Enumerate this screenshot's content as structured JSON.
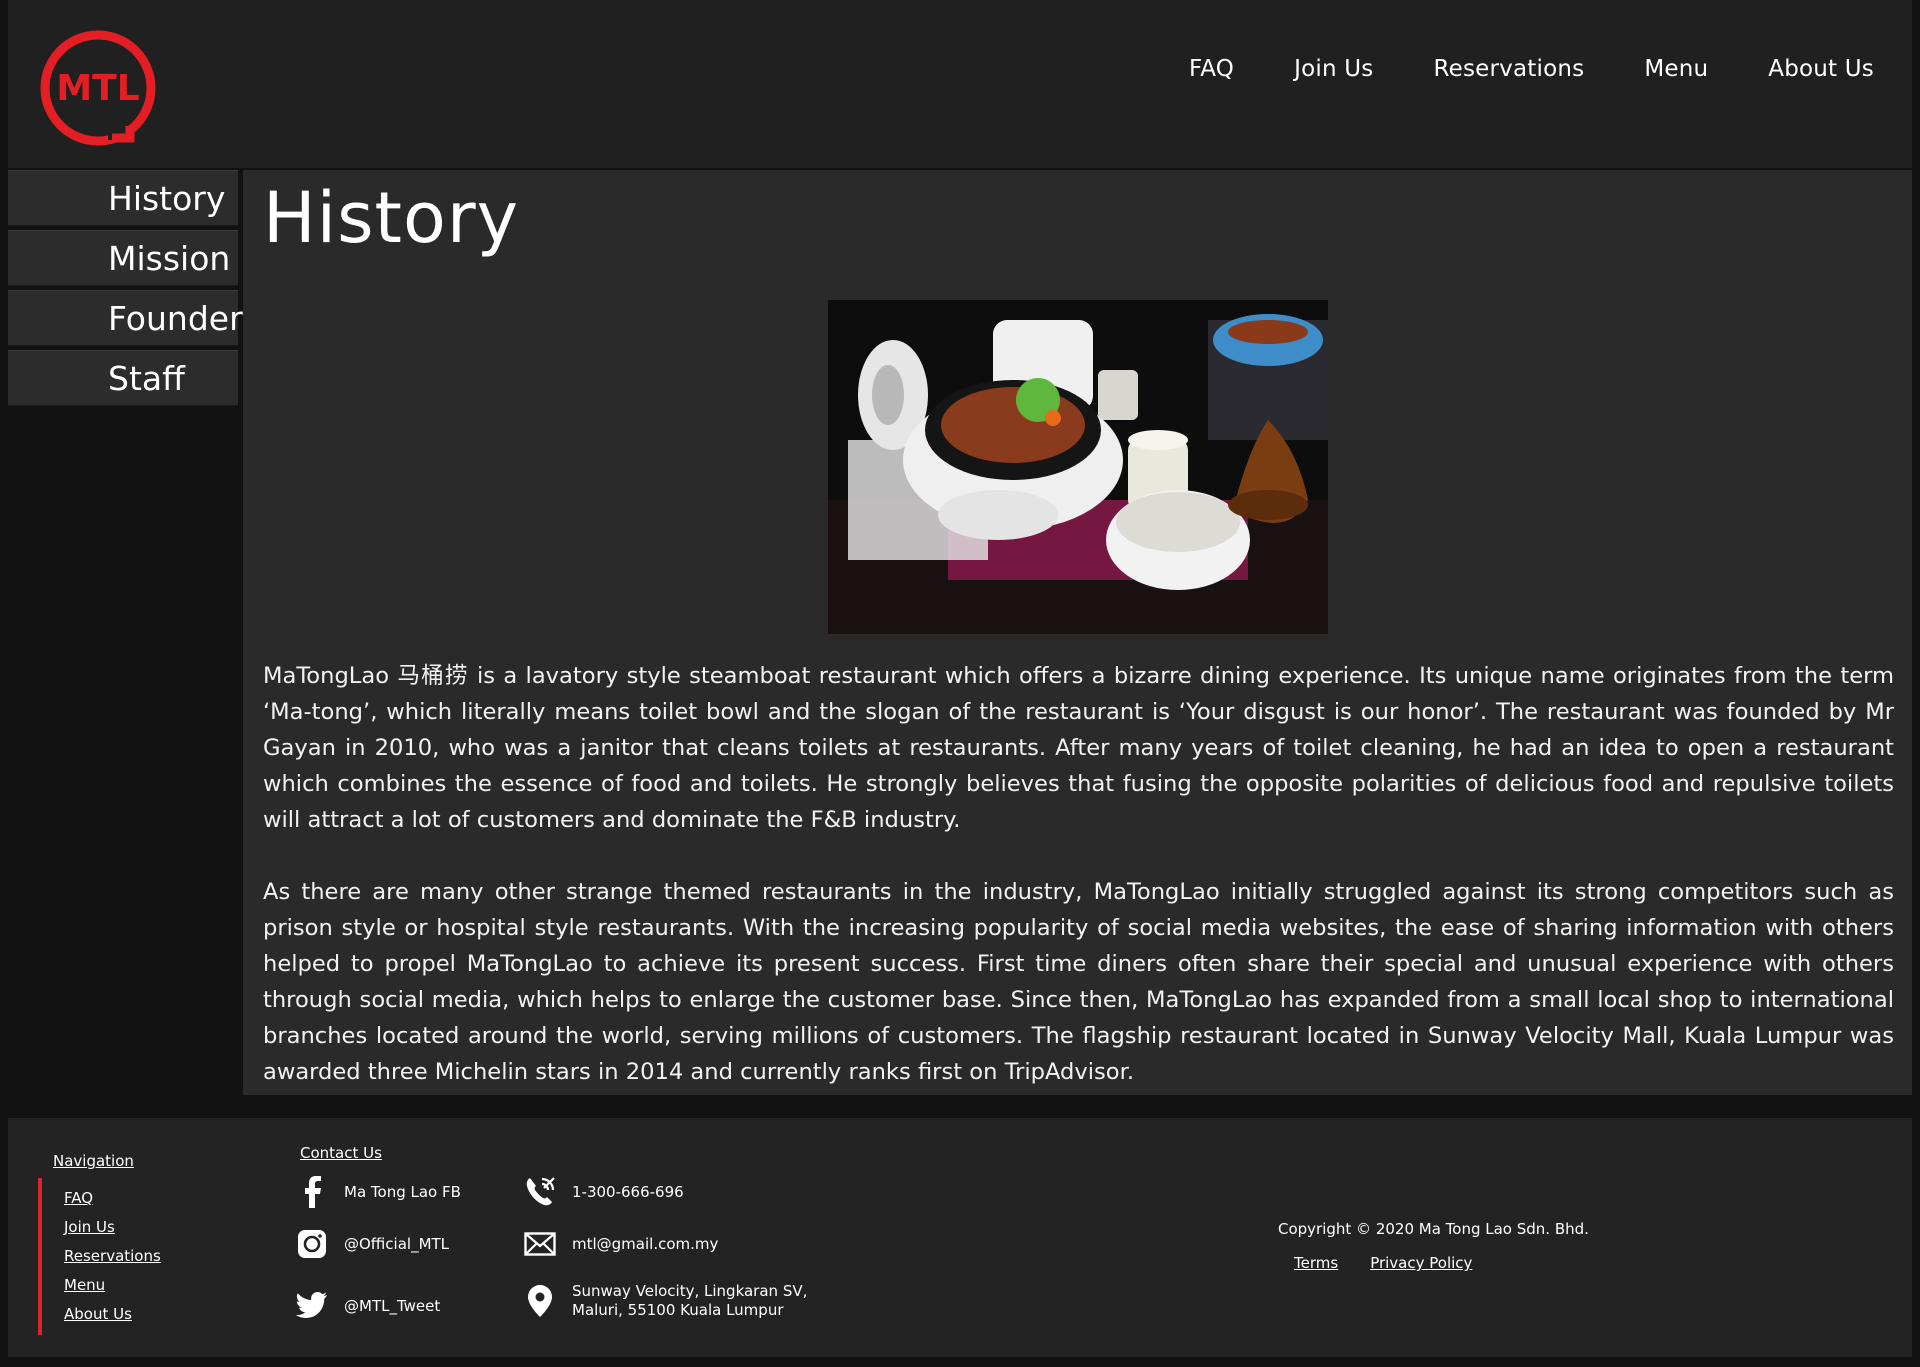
{
  "header": {
    "logo_text": "MTL",
    "nav": [
      "FAQ",
      "Join Us",
      "Reservations",
      "Menu",
      "About Us"
    ]
  },
  "sidebar": {
    "items": [
      "History",
      "Mission",
      "Founder",
      "Staff"
    ]
  },
  "main": {
    "title": "History",
    "paragraphs": [
      "MaTongLao 马桶捞 is a lavatory style steamboat restaurant which offers a bizarre dining experience. Its unique name originates from the term ‘Ma-tong’, which literally means toilet bowl and the slogan of the restaurant is ‘Your disgust is our honor’. The restaurant was founded by Mr Gayan in 2010, who was a janitor that cleans toilets at restaurants. After many years of toilet cleaning, he had an idea to open a restaurant which combines the essence of food and toilets. He strongly believes that fusing the opposite polarities of delicious food and repulsive toilets will attract a lot of customers and dominate the F&B industry.",
      "As there are many other strange themed restaurants in the industry, MaTongLao initially struggled against its strong competitors such as prison style or hospital style restaurants. With the increasing popularity of social media websites, the ease of sharing information with others helped to propel MaTongLao to achieve its present success. First time diners often share their special and unusual experience with others through social media, which helps to enlarge the customer base. Since then, MaTongLao has expanded from a small local shop to international branches located around the world, serving millions of customers. The flagship restaurant located in Sunway Velocity Mall, Kuala Lumpur was awarded three Michelin stars in 2014 and currently ranks first on TripAdvisor."
    ]
  },
  "footer": {
    "navigation_heading": "Navigation",
    "nav": [
      "FAQ",
      "Join Us",
      "Reservations",
      "Menu",
      "About Us"
    ],
    "contact_heading": "Contact Us",
    "facebook": "Ma Tong Lao FB",
    "instagram": "@Official_MTL",
    "twitter": "@MTL_Tweet",
    "phone": "1-300-666-696",
    "email": "mtl@gmail.com.my",
    "address_line1": "Sunway Velocity, Lingkaran SV,",
    "address_line2": "Maluri, 55100 Kuala Lumpur",
    "copyright": "Copyright © 2020 Ma Tong Lao Sdn. Bhd.",
    "terms": "Terms",
    "privacy": "Privacy Policy"
  },
  "colors": {
    "brand_red": "#e31e24",
    "header_bg": "#202020",
    "content_bg": "#2a2a2a",
    "sidebar_bg": "#2c2c2c",
    "footer_bg": "#232323",
    "page_bg": "#121212"
  },
  "icons": [
    "mtl-logo",
    "facebook-icon",
    "instagram-icon",
    "twitter-icon",
    "phone-icon",
    "mail-icon",
    "location-pin-icon"
  ]
}
